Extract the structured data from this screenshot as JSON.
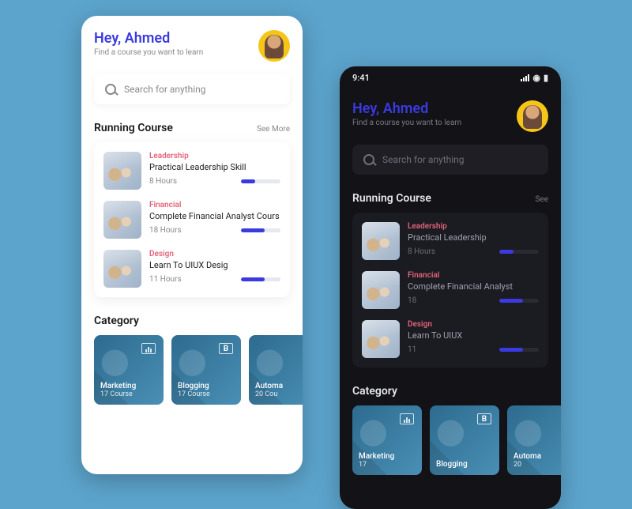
{
  "light": {
    "greeting": "Hey, Ahmed",
    "subgreeting": "Find a course you want to learn",
    "search_placeholder": "Search for anything",
    "running_title": "Running Course",
    "see_more": "See More",
    "courses": [
      {
        "tag": "Leadership",
        "title": "Practical Leadership Skill",
        "hours": "8 Hours",
        "progress": 35
      },
      {
        "tag": "Financial",
        "title": "Complete Financial Analyst Cours",
        "hours": "18 Hours",
        "progress": 60
      },
      {
        "tag": "Design",
        "title": "Learn To UIUX Desig",
        "hours": "11 Hours",
        "progress": 60
      }
    ],
    "category_title": "Category",
    "categories": [
      {
        "name": "Marketing",
        "count": "17 Course"
      },
      {
        "name": "Blogging",
        "count": "17 Course"
      },
      {
        "name": "Automa",
        "count": "20 Cou"
      }
    ]
  },
  "dark": {
    "status_time": "9:41",
    "greeting": "Hey, Ahmed",
    "subgreeting": "Find a course you want to learn",
    "search_placeholder": "Search for anything",
    "running_title": "Running Course",
    "see_more": "See",
    "courses": [
      {
        "tag": "Leadership",
        "title": "Practical Leadership",
        "hours": "8 Hours",
        "progress": 35
      },
      {
        "tag": "Financial",
        "title": "Complete Financial Analyst",
        "hours": "18",
        "progress": 60
      },
      {
        "tag": "Design",
        "title": "Learn To UIUX",
        "hours": "11",
        "progress": 60
      }
    ],
    "category_title": "Category",
    "categories": [
      {
        "name": "Marketing",
        "count": "17"
      },
      {
        "name": "Blogging",
        "count": ""
      },
      {
        "name": "Automa",
        "count": "20"
      }
    ]
  }
}
